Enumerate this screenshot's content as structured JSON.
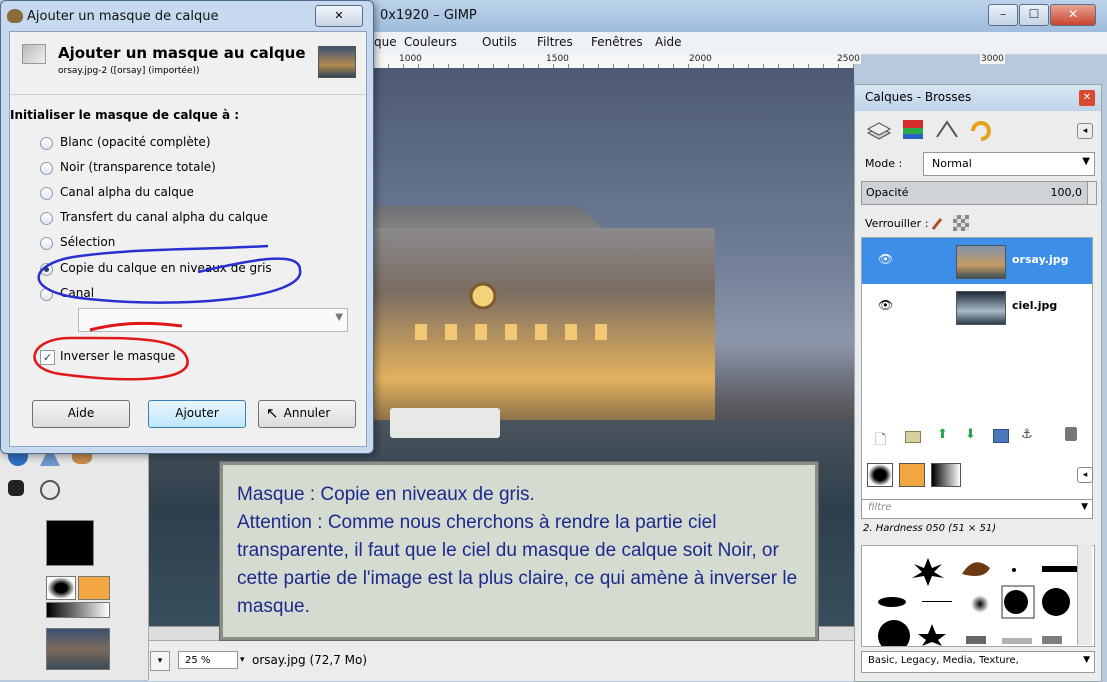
{
  "app": {
    "title": "0x1920 – GIMP",
    "minimize_glyph": "–",
    "maximize_glyph": "☐",
    "close_glyph": "✕"
  },
  "menu": [
    "que",
    "Couleurs",
    "Outils",
    "Filtres",
    "Fenêtres",
    "Aide"
  ],
  "ruler": [
    "1000",
    "1500",
    "2000",
    "2500",
    "3000"
  ],
  "dialog": {
    "window_title": "Ajouter un masque de calque",
    "close_glyph": "✕",
    "header_title": "Ajouter un masque au calque",
    "header_subtitle": "orsay.jpg-2 ([orsay] (importée))",
    "section_label": "Initialiser le masque de calque à :",
    "options": [
      {
        "label": "Blanc (opacité complète)",
        "selected": false
      },
      {
        "label": "Noir (transparence totale)",
        "selected": false
      },
      {
        "label": "Canal alpha du calque",
        "selected": false
      },
      {
        "label": "Transfert du canal alpha du calque",
        "selected": false
      },
      {
        "label": "Sélection",
        "selected": false
      },
      {
        "label": "Copie du calque en niveaux de gris",
        "selected": true
      },
      {
        "label": "Canal",
        "selected": false
      }
    ],
    "invert_label": "Inverser le masque",
    "invert_checked": true,
    "buttons": {
      "help": "Aide",
      "add": "Ajouter",
      "cancel": "Annuler"
    }
  },
  "layers_panel": {
    "title": "Calques - Brosses",
    "mode_label": "Mode :",
    "mode_value": "Normal",
    "opacity_label": "Opacité",
    "opacity_value": "100,0",
    "lock_label": "Verrouiller :",
    "layers": [
      {
        "name": "orsay.jpg",
        "selected": true
      },
      {
        "name": "ciel.jpg",
        "selected": false
      }
    ],
    "filter_placeholder": "filtre",
    "brush_name": "2. Hardness 050 (51 × 51)",
    "tags_value": "Basic, Legacy, Media, Texture,"
  },
  "status": {
    "zoom": "25 %",
    "file_info": "orsay.jpg (72,7 Mo)"
  },
  "note": {
    "line1": "Masque : Copie en niveaux de gris.",
    "line2": "Attention : Comme nous cherchons à rendre la partie ciel transparente, il faut que le ciel du masque de calque soit Noir, or cette partie de l'image est la plus claire, ce qui amène à inverser le masque."
  },
  "colors": {
    "annotation_circle": "#2a2fd0",
    "annotation_red": "#e01818",
    "selected_layer": "#3d8ee6",
    "note_text": "#1b2a8c"
  }
}
